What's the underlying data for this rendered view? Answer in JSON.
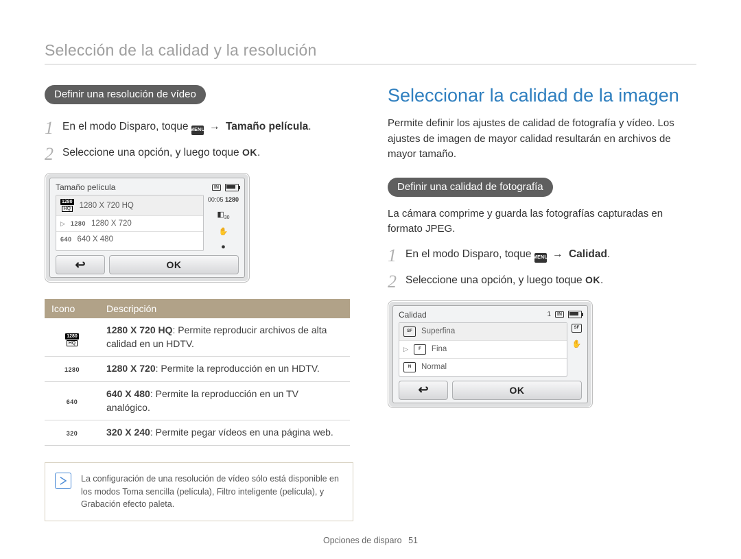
{
  "breadcrumb": "Selección de la calidad y la resolución",
  "left": {
    "pill": "Definir una resolución de vídeo",
    "step1_pre": "En el modo Disparo, toque ",
    "menu_chip": "MENU",
    "step1_post": "Tamaño película",
    "step2": "Seleccione una opción, y luego toque ",
    "ok_glyph": "OK",
    "device": {
      "title": "Tamaño película",
      "status_time": "00:05",
      "status_res": "1280",
      "options": [
        {
          "icon": "1280HQ",
          "label": "1280 X 720 HQ",
          "selected": true
        },
        {
          "icon": "1280",
          "label": "1280 X 720"
        },
        {
          "icon": "640",
          "label": "640 X 480"
        }
      ],
      "back": "↩",
      "ok": "OK"
    },
    "table": {
      "h1": "Icono",
      "h2": "Descripción",
      "rows": [
        {
          "icon": "1280HQ",
          "bold": "1280 X 720 HQ",
          "text": ": Permite reproducir archivos de alta calidad en un HDTV."
        },
        {
          "icon": "1280",
          "bold": "1280 X 720",
          "text": ": Permite la reproducción en un HDTV."
        },
        {
          "icon": "640",
          "bold": "640 X 480",
          "text": ": Permite la reproducción en un TV analógico."
        },
        {
          "icon": "320",
          "bold": "320 X 240",
          "text": ": Permite pegar vídeos en una página web."
        }
      ]
    },
    "note": "La configuración de una resolución de vídeo sólo está disponible en los modos Toma sencilla (película), Filtro inteligente (película), y Grabación efecto paleta."
  },
  "right": {
    "h2": "Seleccionar la calidad de la imagen",
    "intro": "Permite definir los ajustes de calidad de fotografía y vídeo. Los ajustes de imagen de mayor calidad resultarán en archivos de mayor tamaño.",
    "pill": "Definir una calidad de fotografía",
    "intro2": "La cámara comprime y guarda las fotografías capturadas en formato JPEG.",
    "step1_pre": "En el modo Disparo, toque ",
    "step1_post": "Calidad",
    "step2": "Seleccione una opción, y luego toque ",
    "device": {
      "title": "Calidad",
      "status_count": "1",
      "options": [
        {
          "icon": "SF",
          "label": "Superfina",
          "selected": true
        },
        {
          "icon": "F",
          "label": "Fina"
        },
        {
          "icon": "N",
          "label": "Normal"
        }
      ],
      "back": "↩",
      "ok": "OK"
    }
  },
  "footer": {
    "chapter": "Opciones de disparo",
    "page": "51"
  }
}
